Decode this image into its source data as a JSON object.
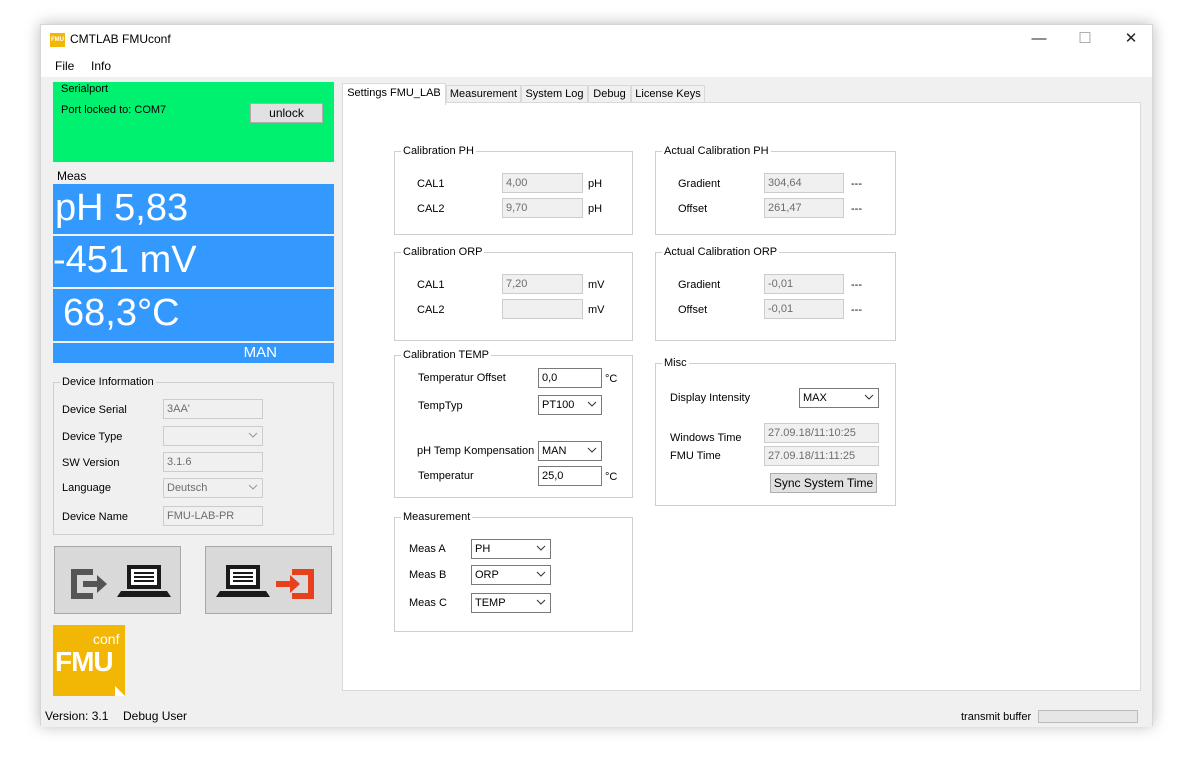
{
  "window": {
    "title": "CMTLAB FMUconf",
    "app_icon_text": "FMU",
    "minimize": "—",
    "maximize": "☐",
    "close": "✕"
  },
  "menu": [
    "File",
    "Info"
  ],
  "serialport": {
    "title": "Serialport",
    "status": "Port locked to: COM7",
    "unlock_label": "unlock",
    "bg_color": "#00f070"
  },
  "meas": {
    "title": "Meas",
    "ph": "pH  5,83",
    "mv": "-451 mV",
    "temp": "68,3°C",
    "mode": "MAN",
    "bg_color": "#3399ff"
  },
  "device_info": {
    "title": "Device Information",
    "serial_label": "Device Serial",
    "serial_value": "3AA'",
    "type_label": "Device Type",
    "type_value": "",
    "sw_label": "SW Version",
    "sw_value": "3.1.6",
    "lang_label": "Language",
    "lang_value": "Deutsch",
    "name_label": "Device Name",
    "name_value": "FMU-LAB-PR"
  },
  "logo": {
    "sup": "conf",
    "main": "FMU",
    "color": "#f2b705"
  },
  "tabs": [
    "Settings FMU_LAB",
    "Measurement",
    "System Log",
    "Debug",
    "License Keys"
  ],
  "calib_ph": {
    "title": "Calibration PH",
    "cal1_label": "CAL1",
    "cal1_value": "4,00",
    "cal1_unit": "pH",
    "cal2_label": "CAL2",
    "cal2_value": "9,70",
    "cal2_unit": "pH"
  },
  "actual_ph": {
    "title": "Actual Calibration PH",
    "gradient_label": "Gradient",
    "gradient_value": "304,64",
    "gradient_unit": "---",
    "offset_label": "Offset",
    "offset_value": "261,47",
    "offset_unit": "---"
  },
  "calib_orp": {
    "title": "Calibration ORP",
    "cal1_label": "CAL1",
    "cal1_value": "7,20",
    "cal1_unit": "mV",
    "cal2_label": "CAL2",
    "cal2_value": "",
    "cal2_unit": "mV"
  },
  "actual_orp": {
    "title": "Actual Calibration ORP",
    "gradient_label": "Gradient",
    "gradient_value": "-0,01",
    "gradient_unit": "---",
    "offset_label": "Offset",
    "offset_value": "-0,01",
    "offset_unit": "---"
  },
  "calib_temp": {
    "title": "Calibration TEMP",
    "offset_label": "Temperatur Offset",
    "offset_value": "0,0",
    "offset_unit": "°C",
    "typ_label": "TempTyp",
    "typ_value": "PT100",
    "komp_label": "pH Temp Kompensation",
    "komp_value": "MAN",
    "temp_label": "Temperatur",
    "temp_value": "25,0",
    "temp_unit": "°C"
  },
  "misc": {
    "title": "Misc",
    "intensity_label": "Display Intensity",
    "intensity_value": "MAX",
    "win_time_label": "Windows Time",
    "win_time_value": "27.09.18/11:10:25",
    "fmu_time_label": "FMU Time",
    "fmu_time_value": "27.09.18/11:11:25",
    "sync_label": "Sync System Time"
  },
  "measurement": {
    "title": "Measurement",
    "a_label": "Meas A",
    "a_value": "PH",
    "b_label": "Meas B",
    "b_value": "ORP",
    "c_label": "Meas C",
    "c_value": "TEMP"
  },
  "status": {
    "version": "Version: 3.1",
    "user": "Debug User",
    "transmit": "transmit buffer",
    "progress": 0
  }
}
